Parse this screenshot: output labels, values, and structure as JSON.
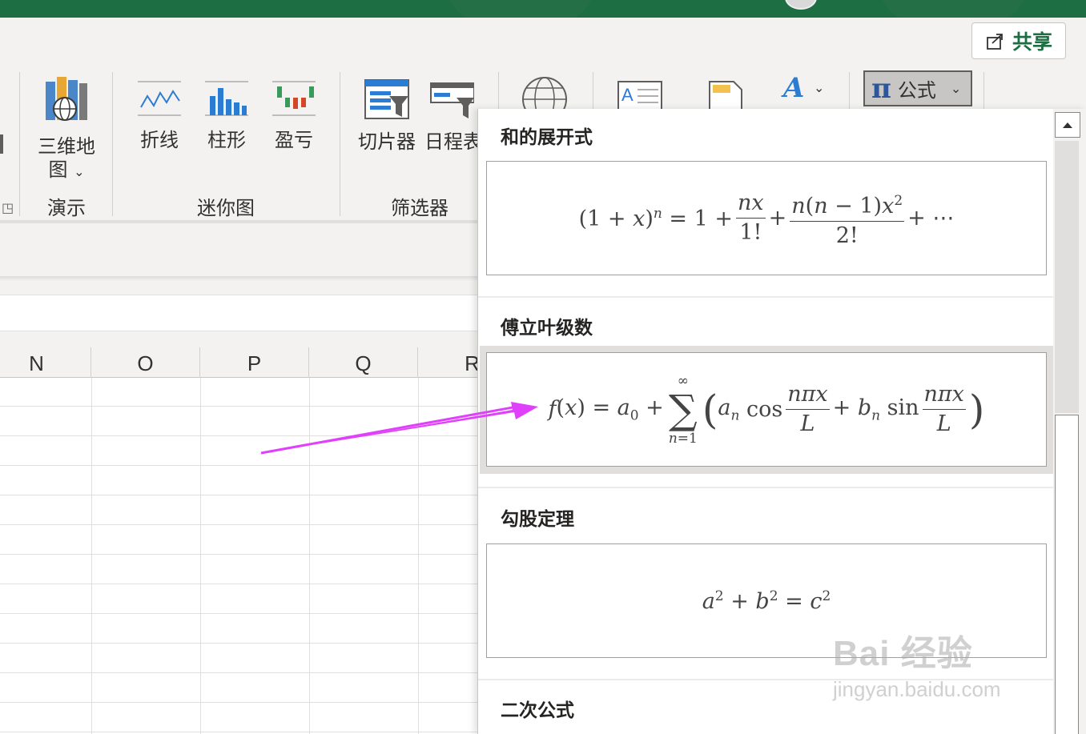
{
  "share_button": {
    "label": "共享"
  },
  "ribbon": {
    "map_button": {
      "label_line1": "三维地",
      "label_line2": "图"
    },
    "group_demo": "演示",
    "sparklines": {
      "line": "折线",
      "column": "柱形",
      "winloss": "盈亏",
      "group": "迷你图"
    },
    "filters": {
      "slicer": "切片器",
      "timeline": "日程表",
      "group": "筛选器"
    },
    "formula_dropdown": {
      "symbol": "π",
      "label": "公式"
    }
  },
  "columns": [
    "N",
    "O",
    "P",
    "Q",
    "R"
  ],
  "gallery": {
    "items": [
      {
        "title": "和的展开式"
      },
      {
        "title": "傅立叶级数"
      },
      {
        "title": "勾股定理"
      },
      {
        "title": "二次公式"
      }
    ]
  },
  "watermark": {
    "brand": "Bai 经验",
    "url": "jingyan.baidu.com"
  },
  "colors": {
    "accent": "#1e6e43",
    "arrow": "#e040fb",
    "pi_blue": "#2b579a"
  }
}
